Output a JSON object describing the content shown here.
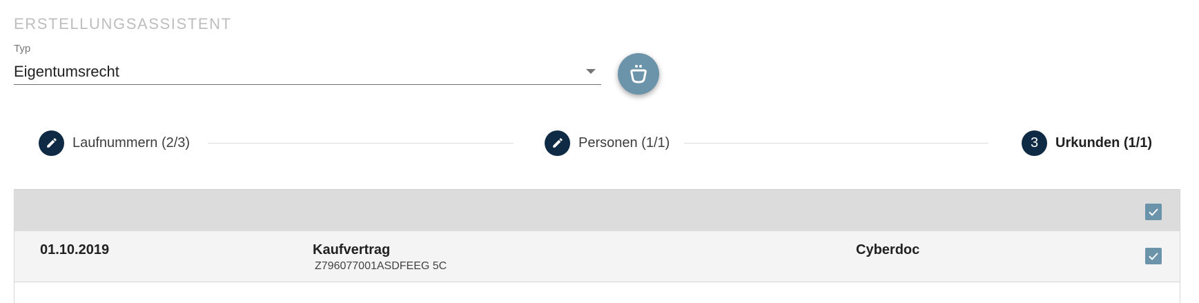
{
  "wizard": {
    "title": "ERSTELLUNGSASSISTENT"
  },
  "type_select": {
    "label": "Typ",
    "value": "Eigentumsrecht",
    "arrow_icon": "dropdown-arrow-icon"
  },
  "fab": {
    "icon": "magic-pot-icon",
    "color": "#6b93a9"
  },
  "stepper": {
    "steps": [
      {
        "label": "Laufnummern (2/3)",
        "icon": "pencil-icon",
        "state": "completed"
      },
      {
        "label": "Personen (1/1)",
        "icon": "pencil-icon",
        "state": "completed"
      },
      {
        "label": "Urkunden (1/1)",
        "number": "3",
        "state": "active"
      }
    ],
    "circle_color": "#0f2a44"
  },
  "table": {
    "header_checked": true,
    "rows": [
      {
        "date": "01.10.2019",
        "doc_type": "Kaufvertrag",
        "doc_number": "Z796077001ASDFEEG 5C",
        "source": "Cyberdoc",
        "checked": true
      }
    ]
  }
}
